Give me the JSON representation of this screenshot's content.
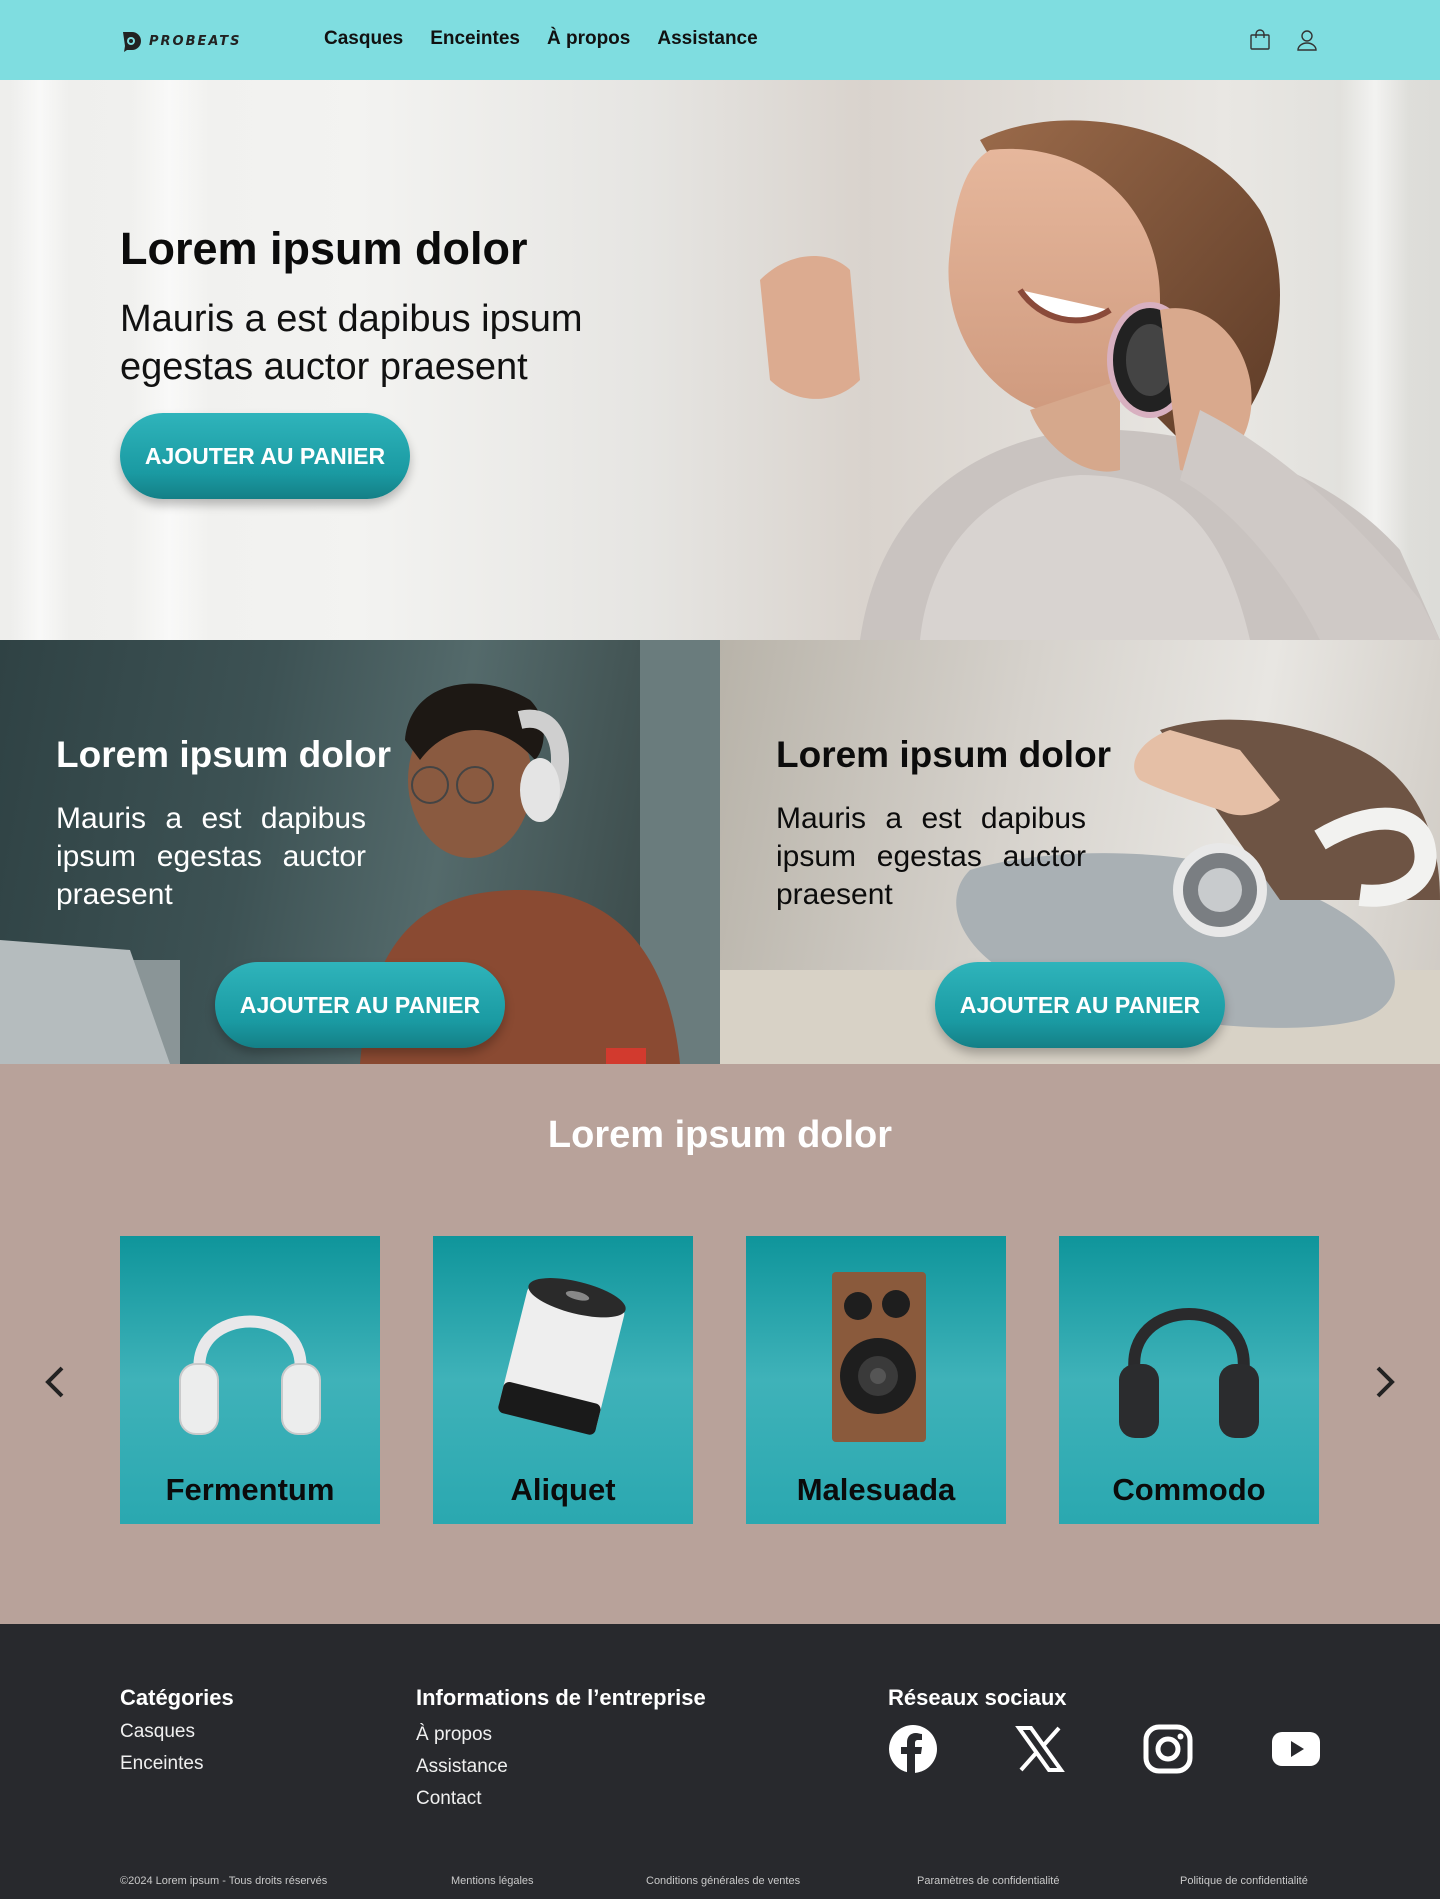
{
  "header": {
    "brand": "PROBEATS",
    "nav": [
      "Casques",
      "Enceintes",
      "À propos",
      "Assistance"
    ],
    "icons": [
      "shopping-bag-icon",
      "user-icon"
    ]
  },
  "hero": {
    "title": "Lorem ipsum dolor",
    "subtitle": "Mauris a est dapibus ipsum egestas auctor praesent",
    "button": "AJOUTER AU PANIER"
  },
  "promos": [
    {
      "title": "Lorem ipsum dolor",
      "text": "Mauris a est dapibus ipsum egestas auctor praesent",
      "button": "AJOUTER AU PANIER"
    },
    {
      "title": "Lorem ipsum dolor",
      "text": "Mauris a est dapibus ipsum egestas auctor praesent",
      "button": "AJOUTER AU PANIER"
    }
  ],
  "products": {
    "title": "Lorem ipsum dolor",
    "items": [
      {
        "name": "Fermentum",
        "icon": "white-headphones-icon"
      },
      {
        "name": "Aliquet",
        "icon": "cylinder-speaker-icon"
      },
      {
        "name": "Malesuada",
        "icon": "bookshelf-speaker-icon"
      },
      {
        "name": "Commodo",
        "icon": "black-headphones-icon"
      }
    ]
  },
  "footer": {
    "categories": {
      "title": "Catégories",
      "links": [
        "Casques",
        "Enceintes"
      ]
    },
    "company": {
      "title": "Informations de l’entreprise",
      "links": [
        "À propos",
        "Assistance",
        "Contact"
      ]
    },
    "social": {
      "title": "Réseaux sociaux",
      "icons": [
        "facebook-icon",
        "x-icon",
        "instagram-icon",
        "youtube-icon"
      ]
    },
    "copyright": "©2024 Lorem ipsum - Tous droits réservés",
    "legal": [
      "Mentions légales",
      "Conditions générales de ventes",
      "Paramètres de confidentialité",
      "Politique de confidentialité"
    ]
  },
  "colors": {
    "header": "#7fdde0",
    "accent": "#1a9aa2",
    "products_bg": "#b8a29a",
    "footer_bg": "#28292d"
  }
}
